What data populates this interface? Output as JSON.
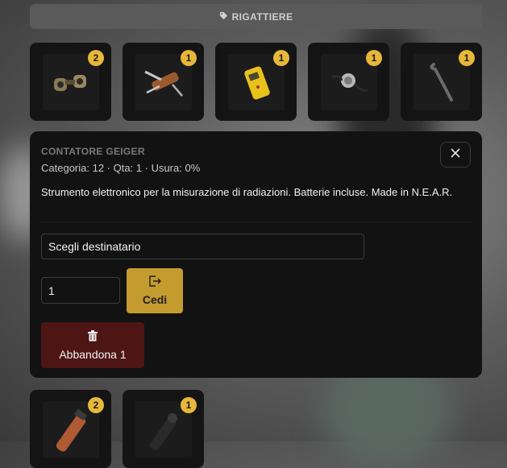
{
  "header": {
    "label": "RIGATTIERE",
    "icon": "tag-icon"
  },
  "items": [
    {
      "icon": "binoculars-icon",
      "count": "2"
    },
    {
      "icon": "multitool-knife-icon",
      "count": "1"
    },
    {
      "icon": "geiger-counter-icon",
      "count": "1"
    },
    {
      "icon": "stethoscope-icon",
      "count": "1"
    },
    {
      "icon": "crowbar-icon",
      "count": "1"
    }
  ],
  "detail": {
    "title": "CONTATORE GEIGER",
    "meta": "Categoria: 12 · Qta: 1 · Usura: 0%",
    "description": "Strumento elettronico per la misurazione di radiazioni. Batterie incluse. Made in N.E.A.R.",
    "recipient_value": "Scegli destinatario",
    "quantity_value": "1",
    "give_label": "Cedi",
    "drop_label": "Abbandona 1"
  },
  "items_row2": [
    {
      "icon": "flare-tube-icon",
      "count": "2"
    },
    {
      "icon": "flashlight-icon",
      "count": "1"
    }
  ],
  "colors": {
    "accent": "#e6b73a",
    "give_button": "#c49b2f",
    "drop_button": "#4e1515",
    "panel": "#121212"
  }
}
